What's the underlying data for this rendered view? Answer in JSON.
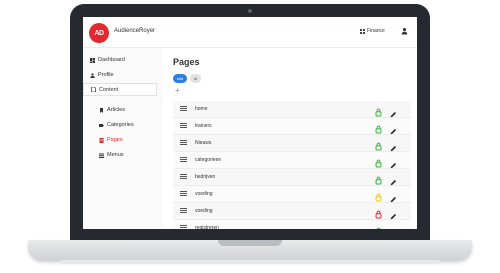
{
  "app": {
    "logo_text": "AD",
    "brand": "AudienceRoyer"
  },
  "header": {
    "finance_label": "Finance"
  },
  "sidebar": {
    "items": [
      {
        "label": "Dashboard",
        "icon": "dashboard-icon"
      },
      {
        "label": "Profile",
        "icon": "user-icon"
      },
      {
        "label": "Content",
        "icon": "file-icon"
      }
    ],
    "content_children": [
      {
        "label": "Articles",
        "icon": "bookmark-icon"
      },
      {
        "label": "Categories",
        "icon": "tag-icon"
      },
      {
        "label": "Pages",
        "icon": "page-icon",
        "selected": true
      },
      {
        "label": "Menus",
        "icon": "menu-icon"
      }
    ]
  },
  "main": {
    "title": "Pages",
    "pill_primary": "edit",
    "pill_secondary": "nl",
    "add_symbol": "+",
    "rows": [
      {
        "name": "home",
        "lock_status": "green"
      },
      {
        "name": "trainers",
        "lock_status": "green"
      },
      {
        "name": "Nieuws",
        "lock_status": "green"
      },
      {
        "name": "categorieen",
        "lock_status": "green"
      },
      {
        "name": "bedrijven",
        "lock_status": "green"
      },
      {
        "name": "voeding",
        "lock_status": "yellow"
      },
      {
        "name": "voeding",
        "lock_status": "red"
      },
      {
        "name": "registreren",
        "lock_status": "green"
      }
    ]
  },
  "colors": {
    "brand_red": "#e4282f",
    "accent_blue": "#2b7fe8",
    "lock_green": "#3cae3f",
    "lock_yellow": "#f0c419",
    "lock_red": "#e4282f"
  }
}
